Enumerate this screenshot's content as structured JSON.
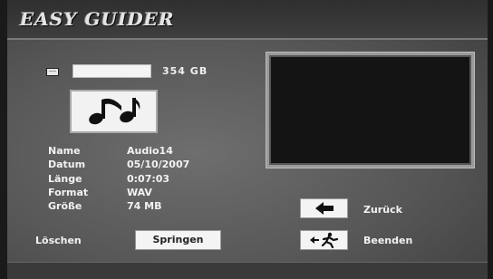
{
  "header": {
    "title": "EASY GUIDER"
  },
  "storage": {
    "capacity": "354 GB",
    "icon": "hard-disk-icon"
  },
  "media_icon": "music-notes-icon",
  "file_info": {
    "labels": {
      "name": "Name",
      "date": "Datum",
      "length": "Länge",
      "format": "Format",
      "size": "Größe"
    },
    "values": {
      "name": "Audio14",
      "date": "05/10/2007",
      "length": "0:07:03",
      "format": "WAV",
      "size": "74 MB"
    }
  },
  "actions": {
    "delete_label": "Löschen",
    "jump_label": "Springen",
    "back_label": "Zurück",
    "exit_label": "Beenden",
    "back_icon": "left-arrow-icon",
    "exit_icon": "exit-running-man-icon"
  }
}
